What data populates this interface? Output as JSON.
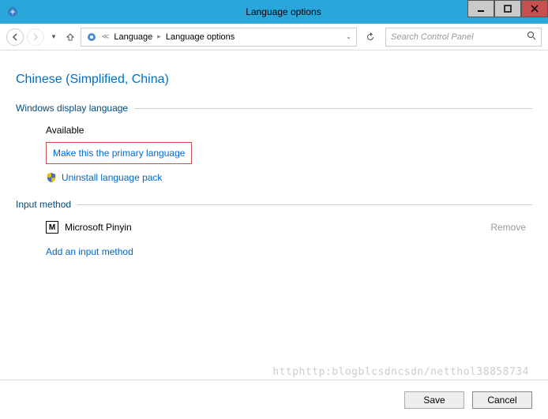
{
  "window": {
    "title": "Language options"
  },
  "breadcrumb": {
    "item1": "Language",
    "item2": "Language options"
  },
  "search": {
    "placeholder": "Search Control Panel"
  },
  "page": {
    "title": "Chinese (Simplified, China)"
  },
  "display_language": {
    "section_label": "Windows display language",
    "status": "Available",
    "make_primary": "Make this the primary language",
    "uninstall": "Uninstall language pack"
  },
  "input_method": {
    "section_label": "Input method",
    "ime_letter": "M",
    "ime_name": "Microsoft Pinyin",
    "remove": "Remove",
    "add": "Add an input method"
  },
  "buttons": {
    "save": "Save",
    "cancel": "Cancel"
  },
  "watermark": "httphttp:blogblcsdncsdn/netthol38858734"
}
